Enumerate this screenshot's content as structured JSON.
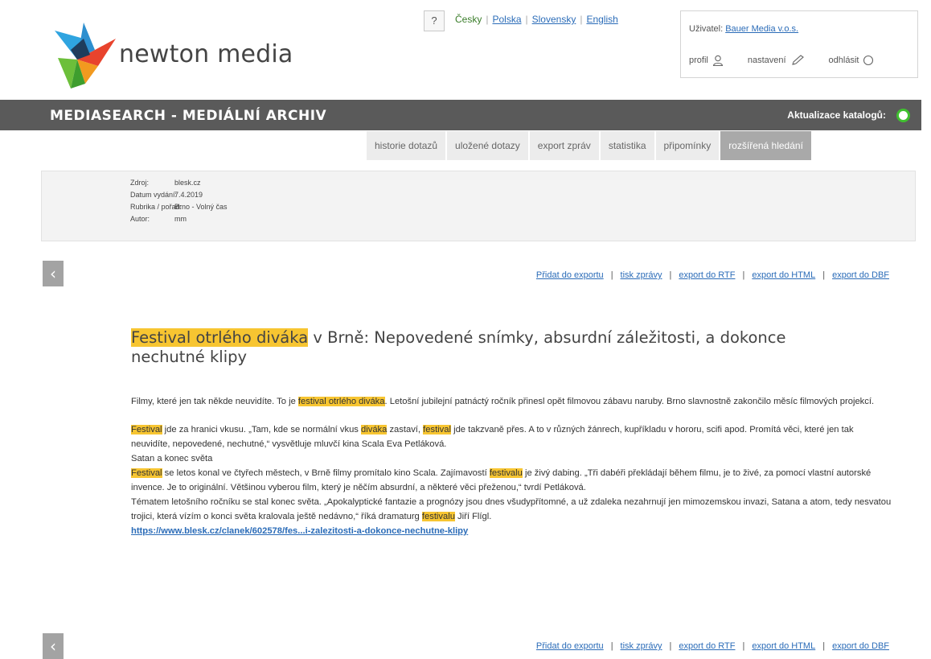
{
  "header": {
    "logo_text": "newton media",
    "help_label": "?",
    "languages": [
      "Česky",
      "Polska",
      "Slovensky",
      "English"
    ],
    "user_label": "Uživatel:",
    "user_name": "Bauer Media v.o.s.",
    "profile_label": "profil",
    "settings_label": "nastavení",
    "logout_label": "odhlásit"
  },
  "titlebar": {
    "title": "MEDIASEARCH - MEDIÁLNÍ ARCHIV",
    "update_label": "Aktualizace katalogů:",
    "update_status_color": "#40c030"
  },
  "tabs": [
    "historie dotazů",
    "uložené dotazy",
    "export zpráv",
    "statistika",
    "připomínky",
    "rozšířená hledání"
  ],
  "info": {
    "source_label": "Zdroj:",
    "source_value": "blesk.cz",
    "date_label": "Datum vydání:",
    "date_value": "7.4.2019",
    "section_label": "Rubrika / pořad:",
    "section_value": "Brno - Volný čas",
    "author_label": "Autor:",
    "author_value": "mm"
  },
  "nav": {
    "prev_icon": "‹",
    "actions": [
      "Přidat do exportu",
      "tisk zprávy",
      "export do RTF",
      "export do HTML",
      "export do DBF"
    ]
  },
  "article": {
    "title_highlight": "Festival otrlého diváka",
    "title_rest": " v Brně: Nepovedené snímky, absurdní záležitosti, a dokonce nechutné klipy",
    "p1_a": "Filmy, které jen tak někde neuvidíte. To je ",
    "p1_hl": "festival otrlého diváka",
    "p1_b": ". Letošní jubilejní patnáctý ročník přinesl opět filmovou zábavu naruby. Brno slavnostně zakončilo měsíc filmových projekcí.",
    "p2_hl1": "Festival",
    "p2_a": " jde za hranici vkusu. „Tam, kde se normální vkus ",
    "p2_hl2": "diváka",
    "p2_b": " zastaví, ",
    "p2_hl3": "festival",
    "p2_c": " jde takzvaně přes. A to v různých žánrech, kupříkladu v hororu, scifi apod. Promítá věci, které jen tak neuvidíte, nepovedené, nechutné,“ vysvětluje mluvčí kina Scala Eva Petláková.",
    "p3": "Satan a konec světa",
    "p4_hl1": "Festival",
    "p4_a": " se letos konal ve čtyřech městech, v Brně filmy promítalo kino Scala. Zajímavostí ",
    "p4_hl2": "festivalu",
    "p4_b": " je živý dabing. „Tři dabéři překládají během filmu, je to živé, za pomocí vlastní autorské invence. Je to originální. Většinou vyberou film, který je něčím absurdní, a některé věci přeženou,“ tvrdí Petláková.",
    "p5_a": "Tématem letošního ročníku se stal konec světa. „Apokalyptické fantazie a prognózy jsou dnes všudypřítomné, a už zdaleka nezahrnují jen mimozemskou invazi, Satana a atom, tedy nesvatou trojici, která vízím o konci světa kralovala ještě nedávno,“ říká dramaturg ",
    "p5_hl": "festivalu",
    "p5_b": " Jiří Flígl.",
    "url": "https://www.blesk.cz/clanek/602578/fes...i-zalezitosti-a-dokonce-nechutne-klipy"
  }
}
